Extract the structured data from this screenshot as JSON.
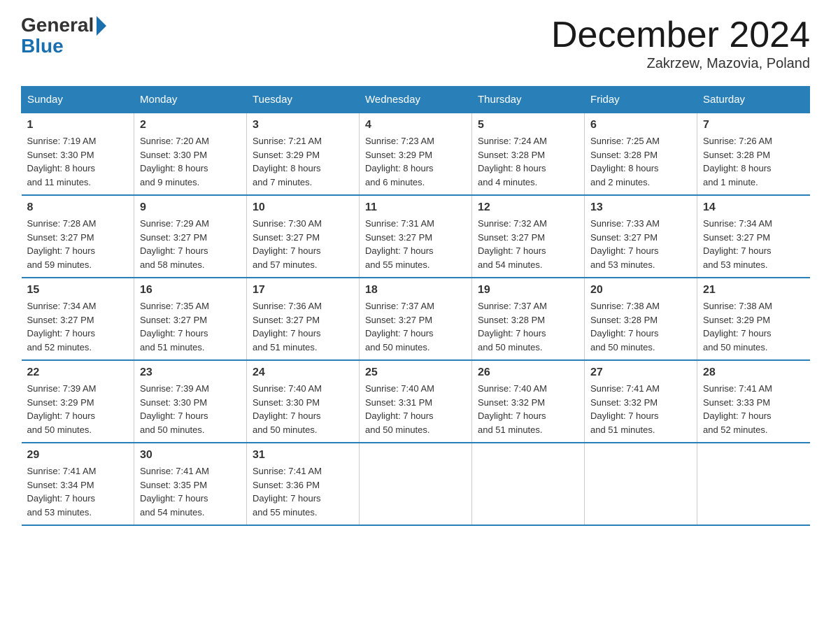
{
  "header": {
    "logo_general": "General",
    "logo_blue": "Blue",
    "month_title": "December 2024",
    "location": "Zakrzew, Mazovia, Poland"
  },
  "weekdays": [
    "Sunday",
    "Monday",
    "Tuesday",
    "Wednesday",
    "Thursday",
    "Friday",
    "Saturday"
  ],
  "weeks": [
    [
      {
        "day": "1",
        "sunrise": "7:19 AM",
        "sunset": "3:30 PM",
        "daylight": "8 hours and 11 minutes."
      },
      {
        "day": "2",
        "sunrise": "7:20 AM",
        "sunset": "3:30 PM",
        "daylight": "8 hours and 9 minutes."
      },
      {
        "day": "3",
        "sunrise": "7:21 AM",
        "sunset": "3:29 PM",
        "daylight": "8 hours and 7 minutes."
      },
      {
        "day": "4",
        "sunrise": "7:23 AM",
        "sunset": "3:29 PM",
        "daylight": "8 hours and 6 minutes."
      },
      {
        "day": "5",
        "sunrise": "7:24 AM",
        "sunset": "3:28 PM",
        "daylight": "8 hours and 4 minutes."
      },
      {
        "day": "6",
        "sunrise": "7:25 AM",
        "sunset": "3:28 PM",
        "daylight": "8 hours and 2 minutes."
      },
      {
        "day": "7",
        "sunrise": "7:26 AM",
        "sunset": "3:28 PM",
        "daylight": "8 hours and 1 minute."
      }
    ],
    [
      {
        "day": "8",
        "sunrise": "7:28 AM",
        "sunset": "3:27 PM",
        "daylight": "7 hours and 59 minutes."
      },
      {
        "day": "9",
        "sunrise": "7:29 AM",
        "sunset": "3:27 PM",
        "daylight": "7 hours and 58 minutes."
      },
      {
        "day": "10",
        "sunrise": "7:30 AM",
        "sunset": "3:27 PM",
        "daylight": "7 hours and 57 minutes."
      },
      {
        "day": "11",
        "sunrise": "7:31 AM",
        "sunset": "3:27 PM",
        "daylight": "7 hours and 55 minutes."
      },
      {
        "day": "12",
        "sunrise": "7:32 AM",
        "sunset": "3:27 PM",
        "daylight": "7 hours and 54 minutes."
      },
      {
        "day": "13",
        "sunrise": "7:33 AM",
        "sunset": "3:27 PM",
        "daylight": "7 hours and 53 minutes."
      },
      {
        "day": "14",
        "sunrise": "7:34 AM",
        "sunset": "3:27 PM",
        "daylight": "7 hours and 53 minutes."
      }
    ],
    [
      {
        "day": "15",
        "sunrise": "7:34 AM",
        "sunset": "3:27 PM",
        "daylight": "7 hours and 52 minutes."
      },
      {
        "day": "16",
        "sunrise": "7:35 AM",
        "sunset": "3:27 PM",
        "daylight": "7 hours and 51 minutes."
      },
      {
        "day": "17",
        "sunrise": "7:36 AM",
        "sunset": "3:27 PM",
        "daylight": "7 hours and 51 minutes."
      },
      {
        "day": "18",
        "sunrise": "7:37 AM",
        "sunset": "3:27 PM",
        "daylight": "7 hours and 50 minutes."
      },
      {
        "day": "19",
        "sunrise": "7:37 AM",
        "sunset": "3:28 PM",
        "daylight": "7 hours and 50 minutes."
      },
      {
        "day": "20",
        "sunrise": "7:38 AM",
        "sunset": "3:28 PM",
        "daylight": "7 hours and 50 minutes."
      },
      {
        "day": "21",
        "sunrise": "7:38 AM",
        "sunset": "3:29 PM",
        "daylight": "7 hours and 50 minutes."
      }
    ],
    [
      {
        "day": "22",
        "sunrise": "7:39 AM",
        "sunset": "3:29 PM",
        "daylight": "7 hours and 50 minutes."
      },
      {
        "day": "23",
        "sunrise": "7:39 AM",
        "sunset": "3:30 PM",
        "daylight": "7 hours and 50 minutes."
      },
      {
        "day": "24",
        "sunrise": "7:40 AM",
        "sunset": "3:30 PM",
        "daylight": "7 hours and 50 minutes."
      },
      {
        "day": "25",
        "sunrise": "7:40 AM",
        "sunset": "3:31 PM",
        "daylight": "7 hours and 50 minutes."
      },
      {
        "day": "26",
        "sunrise": "7:40 AM",
        "sunset": "3:32 PM",
        "daylight": "7 hours and 51 minutes."
      },
      {
        "day": "27",
        "sunrise": "7:41 AM",
        "sunset": "3:32 PM",
        "daylight": "7 hours and 51 minutes."
      },
      {
        "day": "28",
        "sunrise": "7:41 AM",
        "sunset": "3:33 PM",
        "daylight": "7 hours and 52 minutes."
      }
    ],
    [
      {
        "day": "29",
        "sunrise": "7:41 AM",
        "sunset": "3:34 PM",
        "daylight": "7 hours and 53 minutes."
      },
      {
        "day": "30",
        "sunrise": "7:41 AM",
        "sunset": "3:35 PM",
        "daylight": "7 hours and 54 minutes."
      },
      {
        "day": "31",
        "sunrise": "7:41 AM",
        "sunset": "3:36 PM",
        "daylight": "7 hours and 55 minutes."
      },
      null,
      null,
      null,
      null
    ]
  ],
  "labels": {
    "sunrise": "Sunrise:",
    "sunset": "Sunset:",
    "daylight": "Daylight:"
  }
}
